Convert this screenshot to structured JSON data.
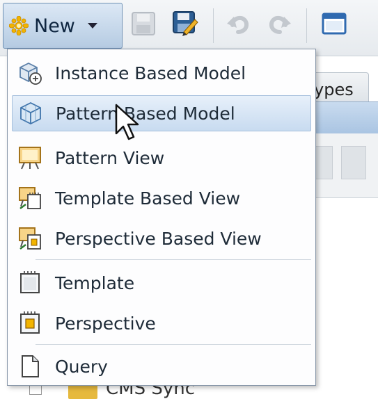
{
  "toolbar": {
    "new_label": "New",
    "icons": [
      "new-star-icon",
      "save-icon",
      "save-as-icon",
      "undo-icon",
      "redo-icon",
      "window-icon"
    ]
  },
  "background": {
    "tab_label": "ypes",
    "tree_item": "CMS Sync"
  },
  "menu": {
    "items": [
      {
        "label": "Instance Based Model",
        "icon": "instance-model-icon"
      },
      {
        "label": "Pattern Based Model",
        "icon": "pattern-model-icon",
        "highlighted": true
      },
      {
        "label": "Pattern View",
        "icon": "pattern-view-icon"
      },
      {
        "label": "Template Based View",
        "icon": "template-view-icon"
      },
      {
        "label": "Perspective Based View",
        "icon": "perspective-view-icon"
      },
      {
        "label": "Template",
        "icon": "template-icon"
      },
      {
        "label": "Perspective",
        "icon": "perspective-icon"
      },
      {
        "label": "Query",
        "icon": "query-icon"
      }
    ]
  },
  "colors": {
    "highlight": "#c8dbf0",
    "accent_blue": "#4a7fc0"
  }
}
